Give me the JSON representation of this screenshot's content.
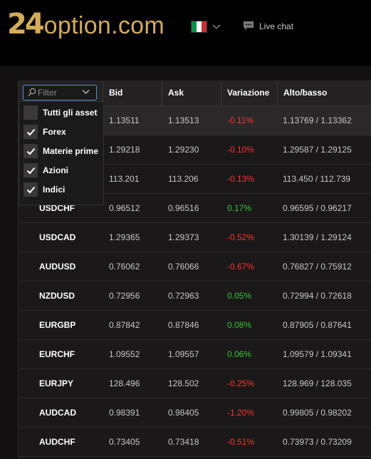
{
  "brand": {
    "logo_number": "24",
    "logo_text": "option.com"
  },
  "header": {
    "language_flag_colors": [
      "#009246",
      "#ffffff",
      "#ce2b37"
    ],
    "chat_label": "Live chat"
  },
  "filter": {
    "placeholder": "Filter",
    "options": [
      {
        "label": "Tutti gli asset",
        "checked": false
      },
      {
        "label": "Forex",
        "checked": true
      },
      {
        "label": "Materie prime",
        "checked": true
      },
      {
        "label": "Azioni",
        "checked": true
      },
      {
        "label": "Indici",
        "checked": true
      }
    ]
  },
  "table": {
    "columns": [
      "Bid",
      "Ask",
      "Variazione",
      "Alto/basso"
    ],
    "rows": [
      {
        "asset": "",
        "bid": "1.13511",
        "ask": "1.13513",
        "change": "-0.11%",
        "range": "1.13769 / 1.13362",
        "dir": "neg"
      },
      {
        "asset": "",
        "bid": "1.29218",
        "ask": "1.29230",
        "change": "-0.10%",
        "range": "1.29587 / 1.29125",
        "dir": "neg"
      },
      {
        "asset": "",
        "bid": "113.201",
        "ask": "113.206",
        "change": "-0.13%",
        "range": "113.450 / 112.739",
        "dir": "neg"
      },
      {
        "asset": "USDCHF",
        "bid": "0.96512",
        "ask": "0.96516",
        "change": "0.17%",
        "range": "0.96595 / 0.96217",
        "dir": "pos"
      },
      {
        "asset": "USDCAD",
        "bid": "1.29365",
        "ask": "1.29373",
        "change": "-0.52%",
        "range": "1.30139 / 1.29124",
        "dir": "neg"
      },
      {
        "asset": "AUDUSD",
        "bid": "0.76062",
        "ask": "0.76066",
        "change": "-0.67%",
        "range": "0.76827 / 0.75912",
        "dir": "neg"
      },
      {
        "asset": "NZDUSD",
        "bid": "0.72956",
        "ask": "0.72963",
        "change": "0.05%",
        "range": "0.72994 / 0.72618",
        "dir": "pos"
      },
      {
        "asset": "EURGBP",
        "bid": "0.87842",
        "ask": "0.87846",
        "change": "0.08%",
        "range": "0.87905 / 0.87641",
        "dir": "pos"
      },
      {
        "asset": "EURCHF",
        "bid": "1.09552",
        "ask": "1.09557",
        "change": "0.06%",
        "range": "1.09579 / 1.09341",
        "dir": "pos"
      },
      {
        "asset": "EURJPY",
        "bid": "128.496",
        "ask": "128.502",
        "change": "-0.25%",
        "range": "128.969 / 128.035",
        "dir": "neg"
      },
      {
        "asset": "AUDCAD",
        "bid": "0.98391",
        "ask": "0.98405",
        "change": "-1.20%",
        "range": "0.99805 / 0.98202",
        "dir": "neg"
      },
      {
        "asset": "AUDCHF",
        "bid": "0.73405",
        "ask": "0.73418",
        "change": "-0.51%",
        "range": "0.73973 / 0.73209",
        "dir": "neg"
      }
    ]
  },
  "colors": {
    "brand_gold": "#d3ac55",
    "negative": "#ff3333",
    "positive": "#39c339",
    "focus_blue": "#5b8fd1"
  },
  "icons": {
    "search": "search-icon",
    "chevron": "chevron-down-icon",
    "chat": "chat-bubble-icon",
    "check": "check-icon"
  }
}
